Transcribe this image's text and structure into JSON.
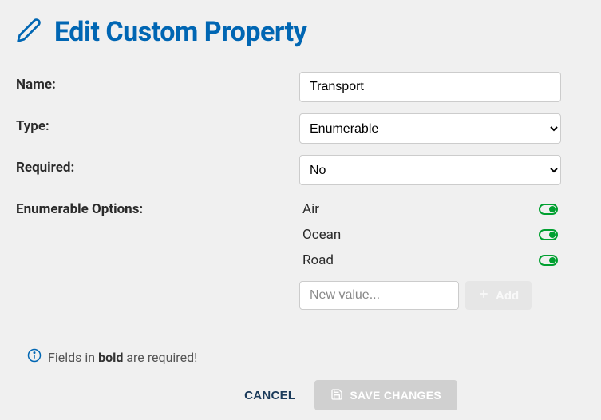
{
  "header": {
    "title": "Edit Custom Property"
  },
  "form": {
    "nameLabel": "Name:",
    "nameValue": "Transport",
    "typeLabel": "Type:",
    "typeValue": "Enumerable",
    "requiredLabel": "Required:",
    "requiredValue": "No",
    "optionsLabel": "Enumerable Options:",
    "options": [
      {
        "label": "Air",
        "enabled": true
      },
      {
        "label": "Ocean",
        "enabled": true
      },
      {
        "label": "Road",
        "enabled": true
      }
    ],
    "newValuePlaceholder": "New value...",
    "addButton": "Add"
  },
  "hint": {
    "prefix": "Fields in ",
    "bold": "bold",
    "suffix": " are required!"
  },
  "actions": {
    "cancel": "CANCEL",
    "save": "SAVE CHANGES"
  }
}
